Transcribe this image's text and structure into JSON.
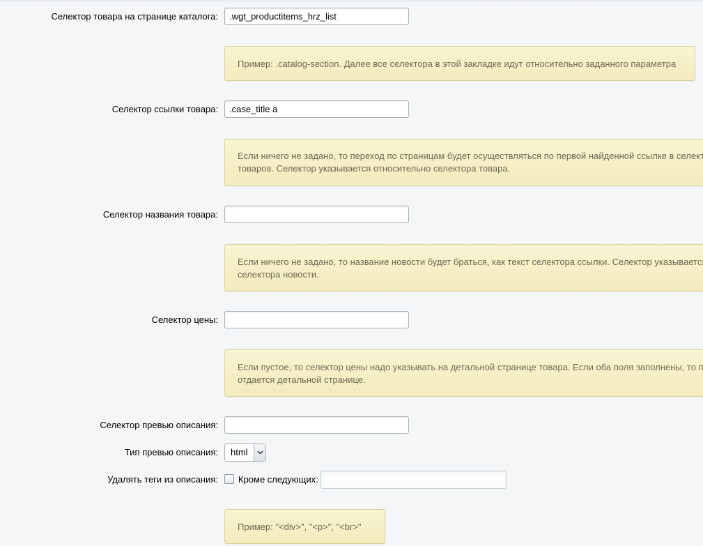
{
  "fields": {
    "catalog_selector": {
      "label": "Селектор товара на странице каталога:",
      "value": ".wgt_productitems_hrz_list"
    },
    "catalog_note": "Пример: .catalog-section. Далее все селектора в этой закладке идут относительно заданного параметра",
    "link_selector": {
      "label": "Селектор ссылки товара:",
      "value": ".case_title a"
    },
    "link_note": {
      "line1": "Если ничего не задано, то переход по страницам будет осуществляться по первой найденной ссылке в селект",
      "line2": "товаров. Селектор указывается относительно селектора товара."
    },
    "name_selector": {
      "label": "Селектор названия товара:",
      "value": ""
    },
    "name_note": {
      "line1": "Если ничего не задано, то название новости будет браться, как текст селектора ссылки. Селектор указывается",
      "line2": "селектора новости."
    },
    "price_selector": {
      "label": "Селектор цены:",
      "value": ""
    },
    "price_note": {
      "line1": "Если пустое, то селектор цены надо указывать на детальной странице товара. Если оба поля заполнены, то пр",
      "line2": "отдается детальной странице."
    },
    "preview_selector": {
      "label": "Селектор превью описания:",
      "value": ""
    },
    "preview_type": {
      "label": "Тип превью описания:",
      "value": "html"
    },
    "strip_tags": {
      "label": "Удалять теги из описания:",
      "checked": false,
      "except_label": "Кроме следующих:",
      "except_value": ""
    },
    "tags_note": "Пример: \"<div>\", \"<p>\", \"<br>\""
  },
  "colors": {
    "background": "#f4f6f8",
    "note_background": "#f6efc6",
    "note_border": "#d9d29a",
    "note_text": "#6e6a52",
    "input_border": "#a7b0b6"
  }
}
